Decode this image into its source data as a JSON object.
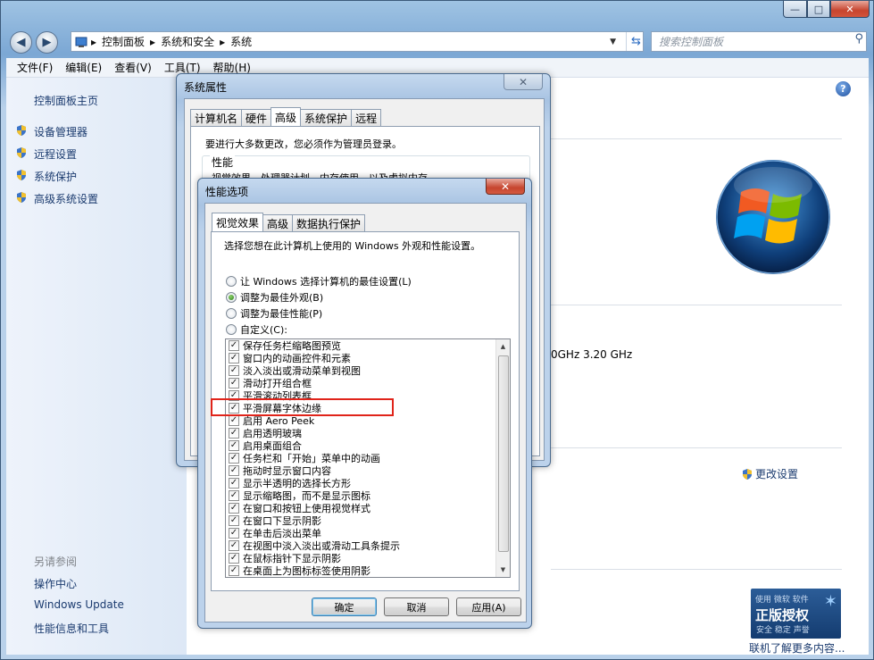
{
  "window": {
    "caption_min": "—",
    "caption_max": "□",
    "caption_close": "✕"
  },
  "address": {
    "back": "◀",
    "forward": "▶",
    "dropdown": "▼",
    "crumbs": [
      "▸",
      "控制面板",
      "▸",
      "系统和安全",
      "▸",
      "系统"
    ],
    "search_placeholder": "搜索控制面板"
  },
  "menu": [
    "文件(F)",
    "编辑(E)",
    "查看(V)",
    "工具(T)",
    "帮助(H)"
  ],
  "left": {
    "home": "控制面板主页",
    "links": [
      "设备管理器",
      "远程设置",
      "系统保护",
      "高级系统设置"
    ],
    "see_also": "另请参阅",
    "also_links": [
      "操作中心",
      "Windows Update",
      "性能信息和工具"
    ]
  },
  "main": {
    "help": "?",
    "cpu_speed": "0GHz   3.20 GHz",
    "change_settings": "更改设置",
    "genuine": {
      "top": "使用 微软 软件",
      "main": "正版授权",
      "sub": "安全 稳定 声誉",
      "link": "联机了解更多内容..."
    }
  },
  "sysprops": {
    "title": "系统属性",
    "close": "✕",
    "tabs": [
      "计算机名",
      "硬件",
      "高级",
      "系统保护",
      "远程"
    ],
    "active_tab": 2,
    "admin_note": "要进行大多数更改，您必须作为管理员登录。",
    "perf_group": "性能",
    "perf_desc": "视觉效果，处理器计划，内存使用，以及虚拟内存"
  },
  "perf": {
    "title": "性能选项",
    "close": "✕",
    "tabs": [
      "视觉效果",
      "高级",
      "数据执行保护"
    ],
    "active_tab": 0,
    "intro": "选择您想在此计算机上使用的 Windows 外观和性能设置。",
    "radios": [
      {
        "label": "让 Windows 选择计算机的最佳设置(L)",
        "checked": false
      },
      {
        "label": "调整为最佳外观(B)",
        "checked": true
      },
      {
        "label": "调整为最佳性能(P)",
        "checked": false
      },
      {
        "label": "自定义(C):",
        "checked": false
      }
    ],
    "check_mark": "✓",
    "options": [
      "保存任务栏缩略图预览",
      "窗口内的动画控件和元素",
      "淡入淡出或滑动菜单到视图",
      "滑动打开组合框",
      "平滑滚动列表框",
      "平滑屏幕字体边缘",
      "启用 Aero Peek",
      "启用透明玻璃",
      "启用桌面组合",
      "任务栏和「开始」菜单中的动画",
      "拖动时显示窗口内容",
      "显示半透明的选择长方形",
      "显示缩略图，而不是显示图标",
      "在窗口和按钮上使用视觉样式",
      "在窗口下显示阴影",
      "在单击后淡出菜单",
      "在视图中淡入淡出或滑动工具条提示",
      "在鼠标指针下显示阴影",
      "在桌面上为图标标签使用阴影"
    ],
    "scroll_up": "▲",
    "scroll_down": "▼",
    "buttons": {
      "ok": "确定",
      "cancel": "取消",
      "apply": "应用(A)"
    }
  }
}
